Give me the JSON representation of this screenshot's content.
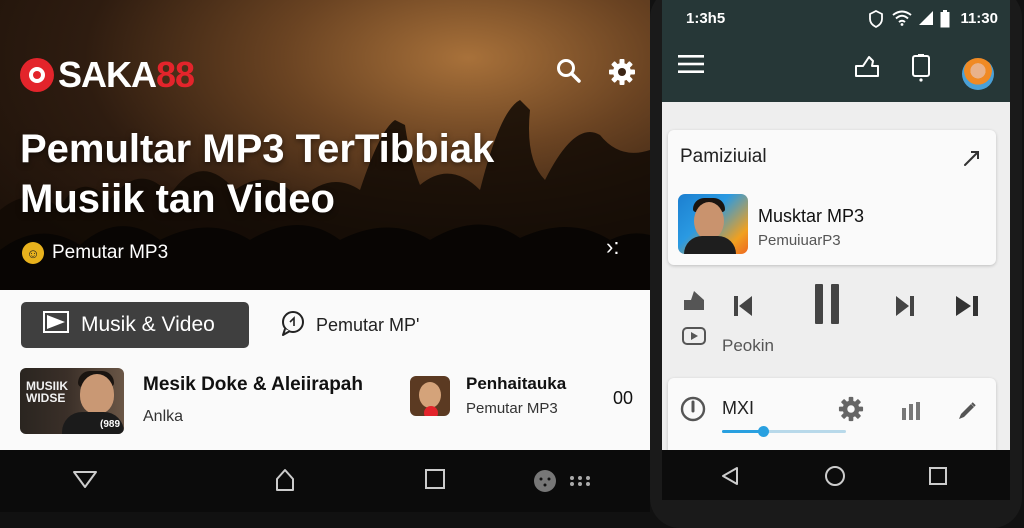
{
  "web": {
    "brand": {
      "prefix": "SAKA",
      "suffix": "88",
      "accent_color": "#e3242b"
    },
    "header_icons": [
      "search-icon",
      "gear-icon"
    ],
    "hero": {
      "title_line1": "Pemultar MP3 TerTibbiak",
      "title_line2": "Musiik tan Video",
      "subtitle": "Pemutar MP3",
      "more_glyph": "›:"
    },
    "tabs": {
      "primary": "Musik & Video",
      "secondary": "Pemutar MP'"
    },
    "tracks": [
      {
        "thumb_text": "MUSIIK WIDSE",
        "thumb_tag": "(989",
        "title": "Mesik Doke & Aleiirapah",
        "subtitle": "Anlka"
      },
      {
        "title": "Penhaitauka",
        "subtitle": "Pemutar MP3",
        "duration": "00"
      }
    ],
    "nav_icons": [
      "back-icon",
      "home-icon",
      "recents-icon",
      "menu-icon"
    ]
  },
  "phone": {
    "status": {
      "time_left": "1:3h5",
      "time_right": "11:30"
    },
    "card1": {
      "heading": "Pamiziuial",
      "track_title": "Musktar MP3",
      "track_subtitle": "PemuiuarP3"
    },
    "controls": {
      "label": "Peokin"
    },
    "card2": {
      "label": "MXI",
      "slider_level": 0.33
    },
    "accent_color": "#29a0e0"
  }
}
